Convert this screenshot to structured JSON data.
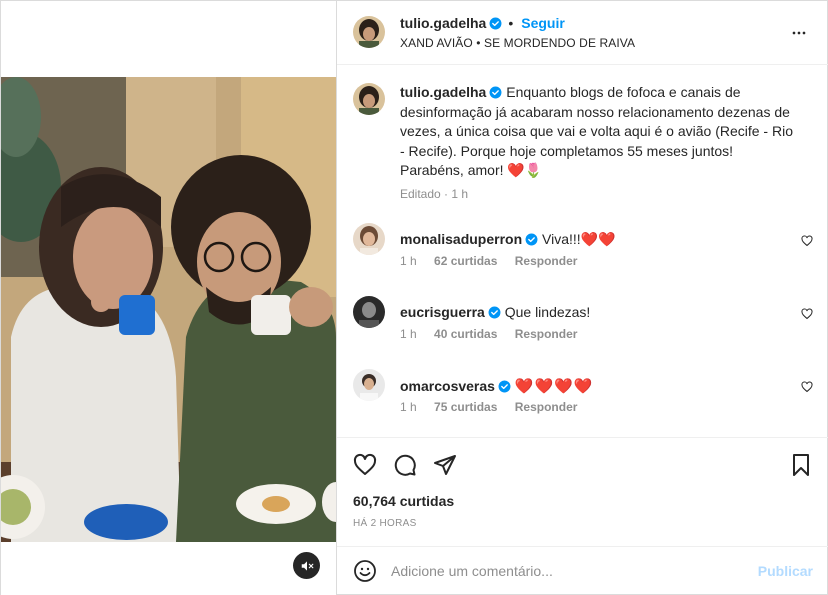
{
  "post": {
    "author": "tulio.gadelha",
    "follow_label": "Seguir",
    "dot": "•",
    "audio": "XAND AVIÃO • SE MORDENDO DE RAIVA"
  },
  "caption": {
    "author": "tulio.gadelha",
    "text": "Enquanto blogs de fofoca e canais de desinformação já acabaram nosso relacionamento dezenas de vezes, a única coisa que vai e volta aqui é o avião (Recife - Rio - Recife). Porque hoje completamos 55 meses juntos! Parabéns, amor! ❤️🌷",
    "edited": "Editado",
    "time": "1 h"
  },
  "comments": [
    {
      "user": "monalisaduperron",
      "text": "Viva!!!❤️❤️",
      "time": "1 h",
      "likes": "62 curtidas",
      "reply": "Responder"
    },
    {
      "user": "eucrisguerra",
      "text": "Que lindezas!",
      "time": "1 h",
      "likes": "40 curtidas",
      "reply": "Responder"
    },
    {
      "user": "omarcosveras",
      "text": "❤️❤️❤️❤️",
      "time": "1 h",
      "likes": "75 curtidas",
      "reply": "Responder"
    }
  ],
  "actions": {
    "likes": "60,764 curtidas",
    "posted": "HÁ 2 HORAS"
  },
  "comment_box": {
    "placeholder": "Adicione um comentário...",
    "publish": "Publicar"
  },
  "colors": {
    "accent": "#0095f6",
    "verified": "#0095f6",
    "heart": "#ed4956"
  }
}
